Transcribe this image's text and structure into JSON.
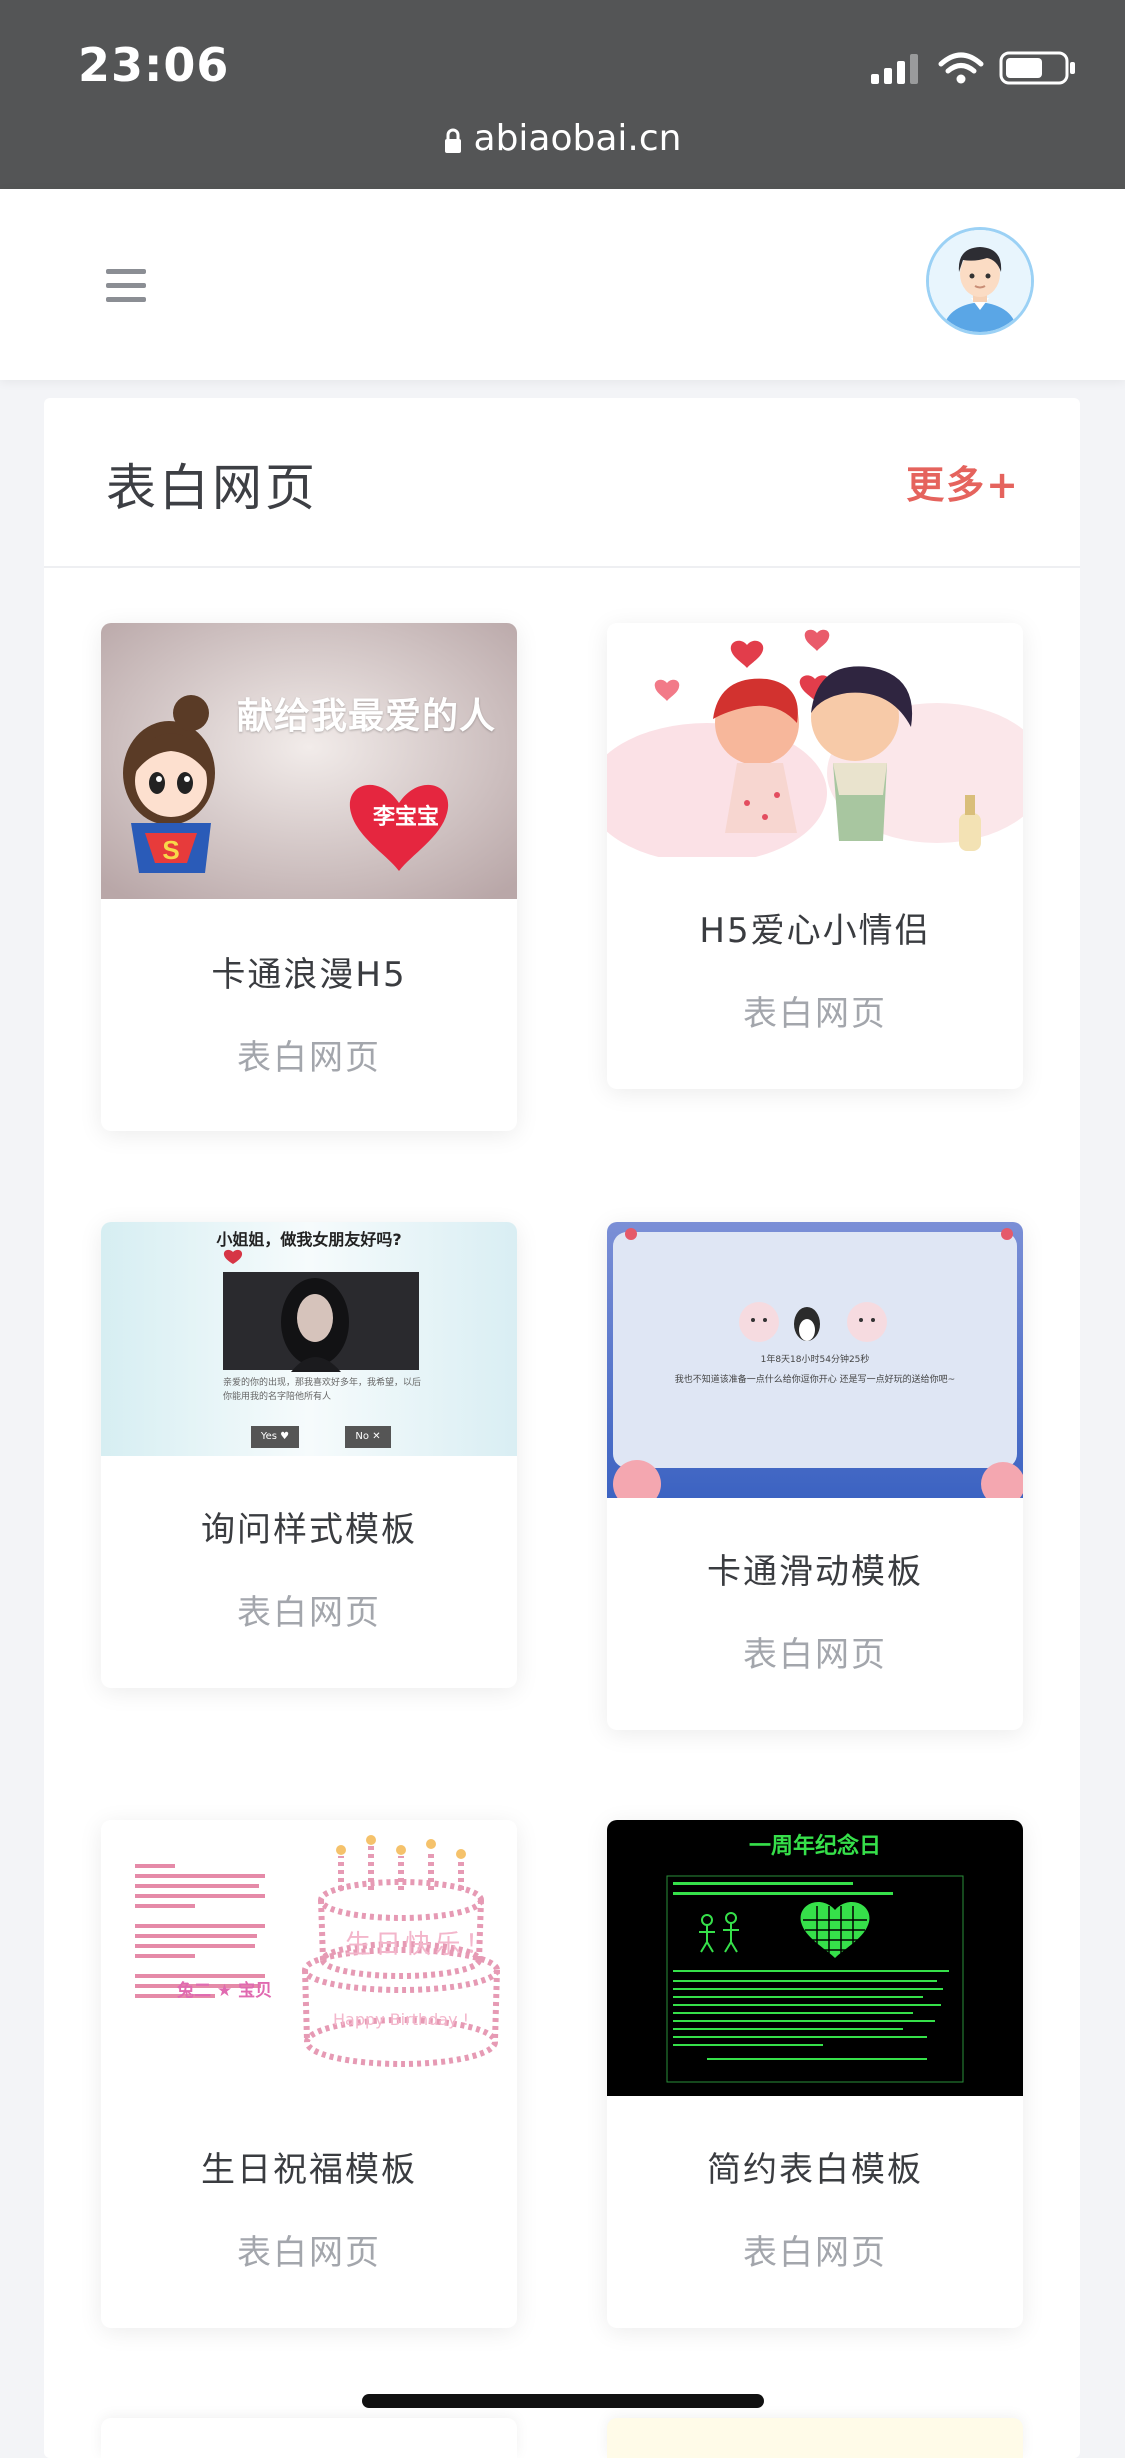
{
  "status_bar": {
    "time": "23:06",
    "url": "abiaobai.cn"
  },
  "header": {
    "menu_icon": "hamburger-menu-icon",
    "avatar_icon": "user-avatar-icon"
  },
  "section": {
    "title": "表白网页",
    "more_label": "更多+"
  },
  "cards": [
    {
      "title": "卡通浪漫H5",
      "subtitle": "表白网页",
      "thumb_text": "献给我最爱的人",
      "thumb_badge": "李宝宝"
    },
    {
      "title": "H5爱心小情侣",
      "subtitle": "表白网页"
    },
    {
      "title": "询问样式模板",
      "subtitle": "表白网页",
      "thumb_text": "小姐姐，做我女朋友好吗?",
      "thumb_body": "亲爱的你的出现，那我喜欢好多年，我希望，以后你能用我的名字陪他所有人",
      "yes_label": "Yes ♥",
      "no_label": "No ✕"
    },
    {
      "title": "卡通滑动模板",
      "subtitle": "表白网页",
      "thumb_text": "1年8天18小时54分钟25秒",
      "thumb_body": "我也不知道该准备一点什么给你逗你开心 还是写一点好玩的送给你吧~"
    },
    {
      "title": "生日祝福模板",
      "subtitle": "表白网页",
      "thumb_text": "兔二 ★ 宝贝",
      "thumb_cake_cn": "生日快乐！",
      "thumb_cake_en": "Happy Birthday !"
    },
    {
      "title": "简约表白模板",
      "subtitle": "表白网页",
      "thumb_text": "一周年纪念日"
    }
  ],
  "colors": {
    "status_bg": "#545556",
    "accent": "#e5635d",
    "page_bg": "#f3f4f7"
  }
}
